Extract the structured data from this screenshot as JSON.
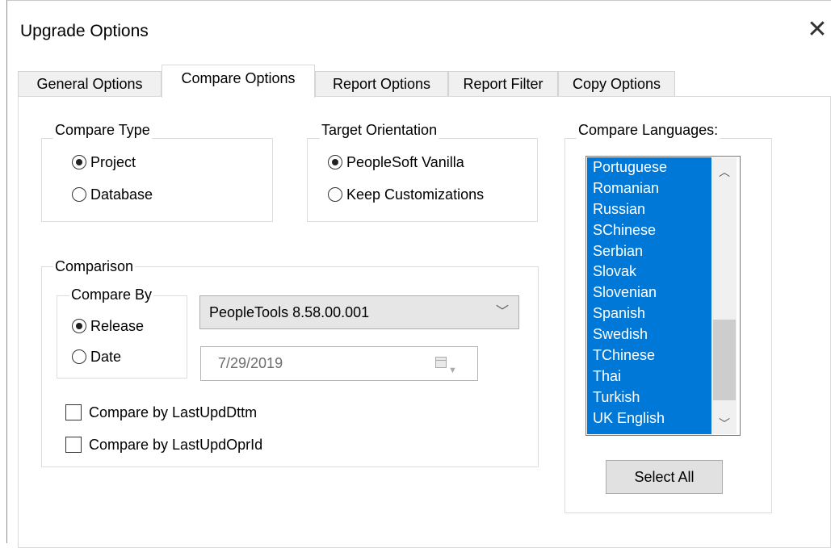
{
  "window": {
    "title": "Upgrade Options",
    "close_glyph": "✕"
  },
  "tabs": [
    {
      "label": "General Options",
      "active": false
    },
    {
      "label": "Compare Options",
      "active": true
    },
    {
      "label": "Report Options",
      "active": false
    },
    {
      "label": "Report Filter",
      "active": false
    },
    {
      "label": "Copy Options",
      "active": false
    }
  ],
  "compare_type": {
    "label": "Compare Type",
    "options": [
      {
        "label": "Project",
        "selected": true
      },
      {
        "label": "Database",
        "selected": false
      }
    ]
  },
  "target_orientation": {
    "label": "Target Orientation",
    "options": [
      {
        "label": "PeopleSoft Vanilla",
        "selected": true
      },
      {
        "label": "Keep Customizations",
        "selected": false
      }
    ]
  },
  "comparison": {
    "label": "Comparison",
    "compare_by": {
      "label": "Compare By",
      "options": [
        {
          "label": "Release",
          "selected": true
        },
        {
          "label": "Date",
          "selected": false
        }
      ]
    },
    "release_select": {
      "value": "PeopleTools 8.58.00.001",
      "icon": "chevron-down-icon"
    },
    "date_field": {
      "value": "7/29/2019",
      "icon": "calendar-icon"
    },
    "checkboxes": [
      {
        "label": "Compare by LastUpdDttm",
        "checked": false
      },
      {
        "label": "Compare by LastUpdOprId",
        "checked": false
      }
    ]
  },
  "compare_languages": {
    "label": "Compare Languages:",
    "items": [
      "Portuguese",
      "Romanian",
      "Russian",
      "SChinese",
      "Serbian",
      "Slovak",
      "Slovenian",
      "Spanish",
      "Swedish",
      "TChinese",
      "Thai",
      "Turkish",
      "UK English"
    ],
    "selected_color": "#0078d7",
    "select_all_label": "Select All"
  }
}
